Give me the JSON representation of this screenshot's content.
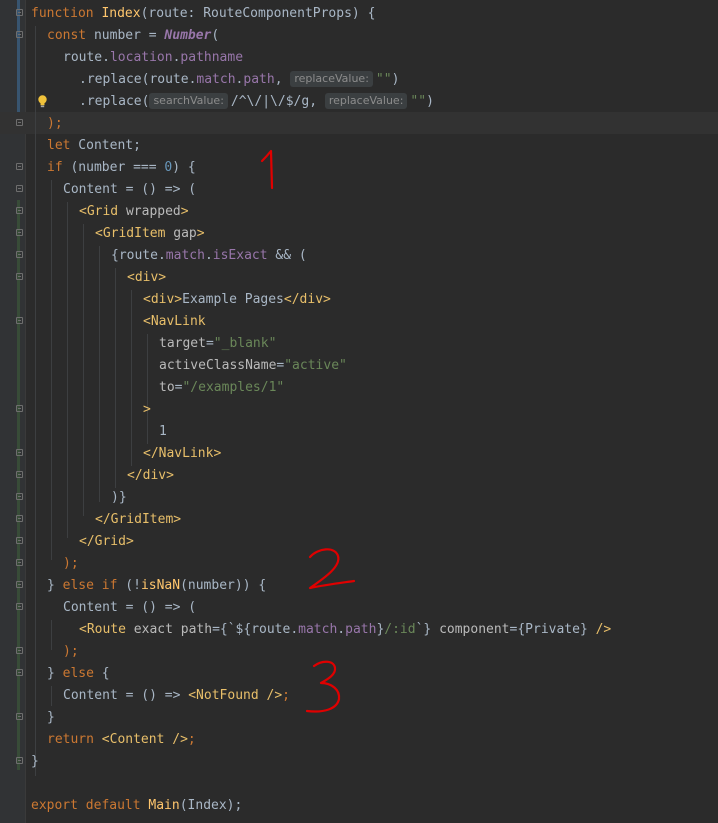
{
  "code": {
    "l1_kw": "function",
    "l1_name": "Index",
    "l1_rest": "(route: RouteComponentProps) {",
    "l2_kw": "const",
    "l2_mid": " number = ",
    "l2_cls": "Number",
    "l2_end": "(",
    "l3_a": "route.",
    "l3_b": "location",
    "l3_c": ".",
    "l3_d": "pathname",
    "l4_a": ".replace(route.",
    "l4_b": "match",
    "l4_c": ".",
    "l4_d": "path",
    "l4_e": ", ",
    "l4_hint": "replaceValue:",
    "l4_str": "\"\"",
    "l4_end": ")",
    "l5_a": ".replace(",
    "l5_hint1": "searchValue:",
    "l5_regex": "/^\\/|\\/$/g",
    "l5_b": ", ",
    "l5_hint2": "replaceValue:",
    "l5_str": "\"\"",
    "l5_end": ")",
    "l6": ");",
    "l7_kw": "let",
    "l7_rest": " Content;",
    "l8_kw": "if",
    "l8_a": " (number === ",
    "l8_num": "0",
    "l8_b": ") {",
    "l9": "Content = () => (",
    "l10_tag": "<Grid",
    "l10_attr": " wrapped",
    "l10_end": ">",
    "l11_tag": "<GridItem",
    "l11_attr": " gap",
    "l11_end": ">",
    "l12_a": "{route.",
    "l12_b": "match",
    "l12_c": ".",
    "l12_d": "isExact",
    "l12_e": " && (",
    "l13": "<div>",
    "l14_tag1": "<div>",
    "l14_text": "Example Pages",
    "l14_tag2": "</div>",
    "l15": "<NavLink",
    "l16_attr": "target",
    "l16_eq": "=",
    "l16_val": "\"_blank\"",
    "l17_attr": "activeClassName",
    "l17_eq": "=",
    "l17_val": "\"active\"",
    "l18_attr": "to",
    "l18_eq": "=",
    "l18_val": "\"/examples/1\"",
    "l19": ">",
    "l20": "1",
    "l21": "</NavLink>",
    "l22": "</div>",
    "l23": ")}",
    "l24": "</GridItem>",
    "l25": "</Grid>",
    "l26": ");",
    "l27_a": "} ",
    "l27_kw1": "else if",
    "l27_b": " (!",
    "l27_fn": "isNaN",
    "l27_c": "(number)) {",
    "l28": "Content = () => (",
    "l29_tag": "<Route",
    "l29_attr1": " exact path",
    "l29_a": "={`${route.",
    "l29_b": "match",
    "l29_c": ".",
    "l29_d": "path",
    "l29_e": "}",
    "l29_str": "/:id",
    "l29_f": "`} ",
    "l29_attr2": "component",
    "l29_g": "={Private} ",
    "l29_tag2": "/>",
    "l30": ");",
    "l31_a": "} ",
    "l31_kw": "else",
    "l31_b": " {",
    "l32_a": "Content = () => ",
    "l32_tag": "<NotFound />",
    "l32_end": ";",
    "l33": "}",
    "l34_kw": "return",
    "l34_sp": " ",
    "l34_tag": "<Content />",
    "l34_end": ";",
    "l35": "}",
    "l37_kw": "export default",
    "l37_fn": " Main",
    "l37_rest": "(Index);"
  },
  "annotations": [
    "1",
    "2",
    "3"
  ],
  "colors": {
    "background": "#2b2b2b",
    "gutter": "#313335",
    "keyword": "#cc7832",
    "function": "#ffc66d",
    "field": "#9876aa",
    "string": "#6a8759",
    "number": "#6897bb",
    "tag": "#e8bf6a",
    "text": "#a9b7c6",
    "annotation": "#ff0000",
    "vcs-modified": "#385570",
    "vcs-added": "#384c38"
  }
}
